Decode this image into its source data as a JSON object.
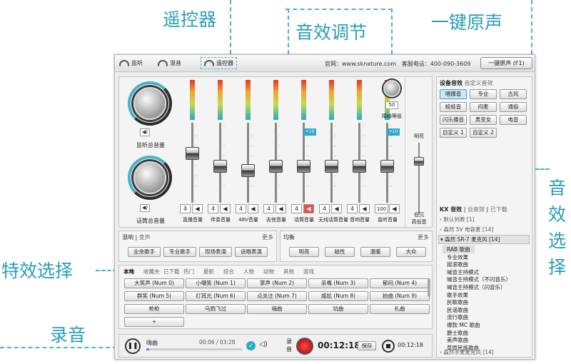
{
  "callouts": {
    "remote": "遥控器",
    "effect_adjust": "音效调节",
    "one_key": "一键原声",
    "sound_select": "音效选择",
    "special": "特效选择",
    "record": "录音"
  },
  "topbar": {
    "monitor": "监听",
    "mix": "混音",
    "remote": "遥控器",
    "site": "官网：www.sknature.com",
    "hotline": "客服电话：400-090-3609",
    "original_btn": "一键原声 (F1)"
  },
  "mixer": {
    "monitor_volume_label": "监听总音量",
    "mic_volume_label": "话筒总音量",
    "channels": [
      {
        "name": "直播音量",
        "value": "4",
        "tag": ""
      },
      {
        "name": "伴奏音量",
        "value": "4",
        "tag": ""
      },
      {
        "name": "48V音量",
        "value": "4",
        "tag": ""
      },
      {
        "name": "吉他音量",
        "value": "4",
        "tag": ""
      },
      {
        "name": "话筒音量",
        "value": "4",
        "tag": "+10"
      },
      {
        "name": "无线话筒音量",
        "value": "4",
        "tag": ""
      },
      {
        "name": "音响音量",
        "value": "4",
        "tag": ""
      },
      {
        "name": "监听音量",
        "value": "100",
        "tag": "+10"
      }
    ],
    "scale": [
      "-0",
      "-100",
      "-50",
      "-50",
      "-100"
    ],
    "noise": {
      "value": "50",
      "label": "降噪等级"
    },
    "lowfreq": {
      "top": "明亮",
      "bottom": "低沉",
      "label": "高低音",
      "ticks": [
        "+10",
        "+5",
        "-5",
        "-10"
      ]
    }
  },
  "reverb": {
    "tabs": [
      "混响",
      "变声"
    ],
    "more": "更多",
    "buttons": [
      "业余歌手",
      "专业歌手",
      "现场表演",
      "说唱表演"
    ]
  },
  "eq": {
    "title": "均衡",
    "more": "更多",
    "buttons": [
      "明亮",
      "磁性",
      "温暖",
      "大众"
    ]
  },
  "fx": {
    "tabs": [
      "本地",
      "收藏夹",
      "已下载",
      "热门",
      "最新",
      "综合",
      "人物",
      "动物",
      "其他",
      "游戏"
    ],
    "buttons": [
      "大笑声 (Num 0)",
      "小嘲笑 (Num 1)",
      "掌声 (Num 2)",
      "亲嘴 (Num 3)",
      "郁闷 (Num 4)",
      "群笑 (Num 5)",
      "打耳光 (Num 6)",
      "点关注 (Num 7)",
      "尴尬 (Num 8)",
      "拍曲 (Num 9)",
      "枪枪",
      "乌鸦飞过",
      "嗨曲",
      "坑曲",
      "礼曲"
    ],
    "add": "+"
  },
  "record": {
    "song": "嗨曲",
    "time": "00:06 / 03:28",
    "rec_label": "录音",
    "rec_time": "00:12:18",
    "save": "保存",
    "play_time": "00:12:18"
  },
  "sound": {
    "tabs": [
      "设备音效",
      "自定义音效"
    ],
    "buttons": [
      "唱播音",
      "专业",
      "古风",
      "蛙蛙音",
      "闷麦",
      "通俗",
      "闪乐播音",
      "男变女",
      "电音",
      "自定义 1",
      "自定义 2"
    ],
    "kx_tabs": [
      "KX 音效",
      "云音效",
      "已下载"
    ],
    "groups": [
      "默认列表 [1]",
      "森然 5V 电容麦 [14]",
      "森然 SR-7 麦克风 [14]"
    ],
    "items": [
      "RAB 歌曲",
      "专业效果",
      "摇滚歌曲",
      "喊音主持模式",
      "喊音主持模式（不闪音乐）",
      "喊音主持模式（闪音乐）",
      "歌手效果",
      "民歌歌曲",
      "民谣歌曲",
      "流行歌曲",
      "爆款 MC 歌曲",
      "爵士歌曲",
      "美声歌曲",
      "草原民族歌曲"
    ],
    "footer_group": "森然手麦麦克风 [14]"
  }
}
